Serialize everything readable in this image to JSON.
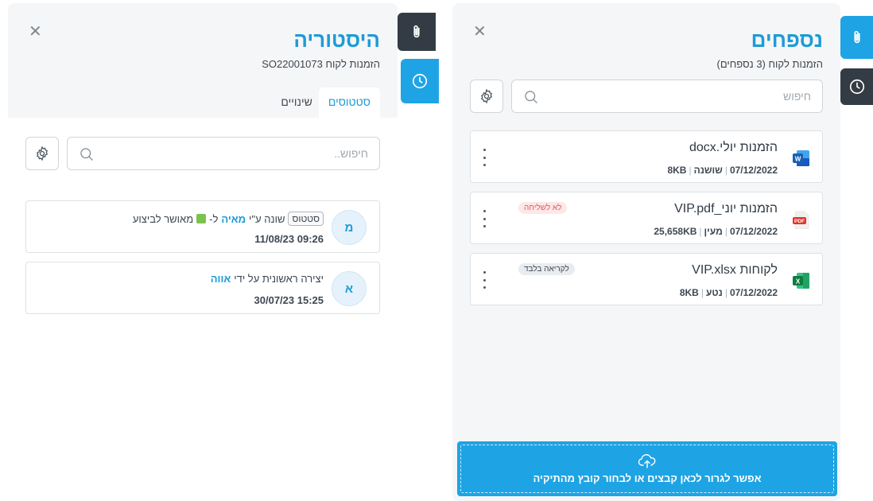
{
  "history": {
    "title": "היסטוריה",
    "subtitle": "הזמנות לקוח SO22001073",
    "tabs": [
      {
        "label": "סטטוסים",
        "active": true
      },
      {
        "label": "שינויים",
        "active": false
      }
    ],
    "search_placeholder": "חיפוש..",
    "entries": [
      {
        "avatar": "מ",
        "chip": "סטטוס",
        "text_changed_by": "שונה ע\"י",
        "user": "מאיה",
        "text_to": "ל-",
        "status_label": "מאושר לביצוע",
        "status_color": "#7cc24e",
        "time": "09:26 11/08/23"
      },
      {
        "avatar": "א",
        "text_created_by": "יצירה ראשונית על ידי",
        "user": "אווה",
        "time": "15:25 30/07/23"
      }
    ]
  },
  "files": {
    "title": "נספחים",
    "subtitle": "הזמנות לקוח (3 נספחים)",
    "search_placeholder": "חיפוש",
    "items": [
      {
        "name": "הזמנות יולי.docx",
        "size": "8KB",
        "owner": "שושנה",
        "date": "07/12/2022",
        "type": "word",
        "badge": ""
      },
      {
        "name": "הזמנות יוני_VIP.pdf",
        "size": "25,658KB",
        "owner": "מעין",
        "date": "07/12/2022",
        "type": "pdf",
        "badge": "לא לשליחה"
      },
      {
        "name": "לקוחות VIP.xlsx",
        "size": "8KB",
        "owner": "נטע",
        "date": "07/12/2022",
        "type": "excel",
        "badge": "לקריאה בלבד"
      }
    ],
    "upload_text": "אפשר לגרור לכאן קבצים או לבחור קובץ מהתיקיה"
  },
  "icons": {
    "attach": "paperclip-icon",
    "history": "clock-icon",
    "close": "close-icon",
    "settings": "gear-icon",
    "search": "search-icon",
    "more": "kebab-icon",
    "upload": "cloud-upload-icon"
  },
  "colors": {
    "accent": "#1ea4e4",
    "title": "#1d9bd7",
    "dark_tab": "#333c44"
  }
}
